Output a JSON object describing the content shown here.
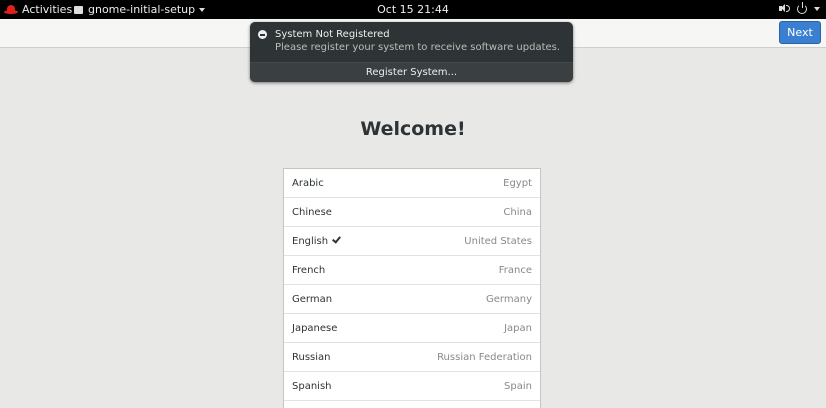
{
  "topbar": {
    "activities": "Activities",
    "app_name": "gnome-initial-setup",
    "clock": "Oct 15  21:44"
  },
  "header": {
    "next_label": "Next"
  },
  "notification": {
    "title": "System Not Registered",
    "body": "Please register your system to receive software updates.",
    "action": "Register System..."
  },
  "page": {
    "title": "Welcome!"
  },
  "languages": [
    {
      "name": "Arabic",
      "region": "Egypt",
      "selected": false
    },
    {
      "name": "Chinese",
      "region": "China",
      "selected": false
    },
    {
      "name": "English",
      "region": "United States",
      "selected": true
    },
    {
      "name": "French",
      "region": "France",
      "selected": false
    },
    {
      "name": "German",
      "region": "Germany",
      "selected": false
    },
    {
      "name": "Japanese",
      "region": "Japan",
      "selected": false
    },
    {
      "name": "Russian",
      "region": "Russian Federation",
      "selected": false
    },
    {
      "name": "Spanish",
      "region": "Spain",
      "selected": false
    }
  ],
  "colors": {
    "accent": "#3b80d0",
    "topbar": "#000000",
    "notification_bg": "#2e3436"
  }
}
